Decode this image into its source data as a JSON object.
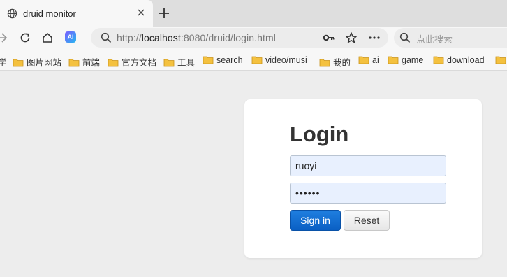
{
  "tab": {
    "title": "druid monitor"
  },
  "toolbar": {
    "url_scheme": "http://",
    "url_host": "localhost",
    "url_rest": ":8080/druid/login.html",
    "ai_badge": "AI",
    "search_placeholder": "点此搜索"
  },
  "bookmarks": [
    {
      "label": "学",
      "folder": false
    },
    {
      "label": "图片网站",
      "folder": true
    },
    {
      "label": "前端",
      "folder": true
    },
    {
      "label": "官方文档",
      "folder": true
    },
    {
      "label": "工具",
      "folder": true
    },
    {
      "label": "search",
      "folder": true
    },
    {
      "label": "video/musi",
      "folder": true
    },
    {
      "label": "我的",
      "folder": true
    },
    {
      "label": "ai",
      "folder": true
    },
    {
      "label": "game",
      "folder": true
    },
    {
      "label": "download",
      "folder": true
    }
  ],
  "login": {
    "heading": "Login",
    "username": "ruoyi",
    "password_mask": "••••••",
    "signin_label": "Sign in",
    "reset_label": "Reset"
  },
  "colors": {
    "signin_button": "#0a5fc4",
    "input_autofill": "#e8f0fe",
    "folder": "#f4c13f"
  }
}
